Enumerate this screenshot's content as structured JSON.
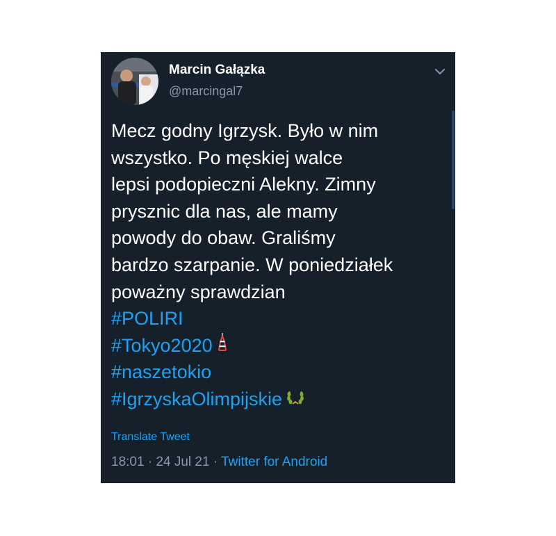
{
  "tweet": {
    "author": {
      "display_name": "Marcin Gałązka",
      "handle": "@marcingal7",
      "avatar_icon": "profile-photo"
    },
    "menu_icon": "chevron-down-icon",
    "text_lines": [
      "Mecz godny Igrzysk. Było w nim",
      "wszystko. Po męskiej walce",
      "lepsi podopieczni Alekny. Zimny",
      "prysznic dla nas, ale mamy",
      "powody do obaw. Graliśmy",
      "bardzo szarpanie. W poniedziałek",
      "poważny sprawdzian"
    ],
    "hashtags": [
      {
        "text": "#POLIRI"
      },
      {
        "text": "#Tokyo2020",
        "emoji": "tokyo-tower-icon"
      },
      {
        "text": "#naszetokio"
      },
      {
        "text": "#IgrzyskaOlimpijskie",
        "emoji": "laurel-wreath-icon"
      }
    ],
    "translate_label": "Translate Tweet",
    "time": "18:01",
    "separator": " · ",
    "date": "24 Jul 21",
    "source": "Twitter for Android"
  },
  "colors": {
    "background": "#15202b",
    "text": "#ffffff",
    "muted": "#8899a6",
    "accent": "#1da1f2"
  }
}
